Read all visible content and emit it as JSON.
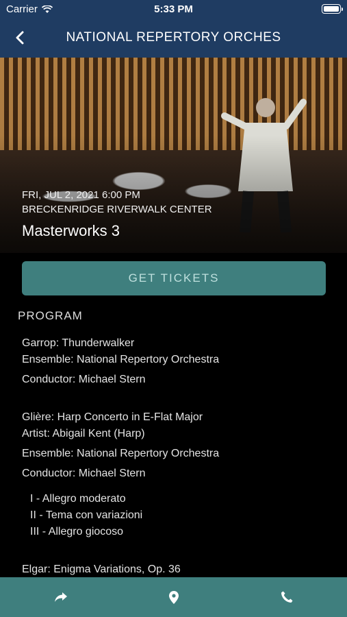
{
  "status": {
    "carrier": "Carrier",
    "time": "5:33 PM"
  },
  "nav": {
    "title": "NATIONAL REPERTORY ORCHES"
  },
  "event": {
    "date": "FRI, JUL 2, 2021 6:00 PM",
    "venue": "BRECKENRIDGE RIVERWALK CENTER",
    "name": "Masterworks 3"
  },
  "tickets_label": "GET TICKETS",
  "program_heading": "PROGRAM",
  "program": {
    "p1_work": "Garrop: Thunderwalker",
    "p1_ensemble": "Ensemble: National Repertory Orchestra",
    "p1_conductor": "Conductor: Michael Stern",
    "p2_work": "Glière: Harp Concerto in E-Flat Major",
    "p2_artist": "Artist: Abigail Kent (Harp)",
    "p2_ensemble": "Ensemble: National Repertory Orchestra",
    "p2_conductor": "Conductor: Michael Stern",
    "mv1": "I - Allegro moderato",
    "mv2": "II - Tema con variazioni",
    "mv3": "III - Allegro giocoso",
    "p3_work": "Elgar: Enigma Variations, Op. 36"
  },
  "icons": {
    "back": "chevron-left-icon",
    "wifi": "wifi-icon",
    "battery": "battery-icon",
    "share": "share-icon",
    "location": "map-pin-icon",
    "phone": "phone-icon"
  },
  "colors": {
    "nav": "#1f3c62",
    "accent": "#3f7f7e",
    "background": "#000000"
  }
}
